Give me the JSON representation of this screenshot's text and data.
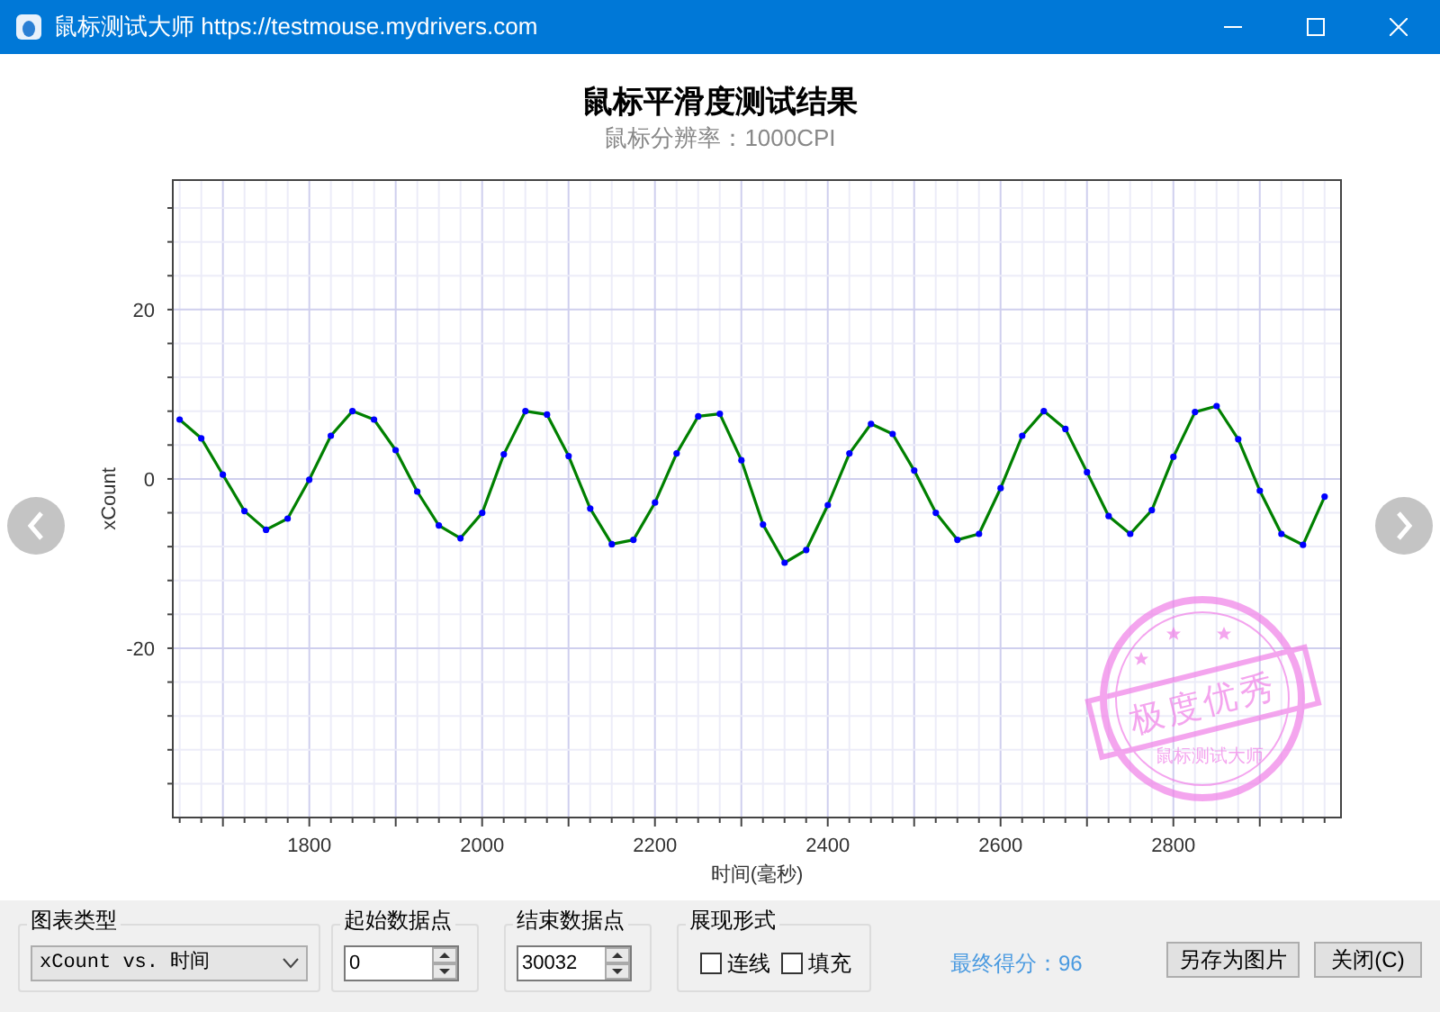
{
  "window": {
    "title": "鼠标测试大师 https://testmouse.mydrivers.com"
  },
  "chart": {
    "title": "鼠标平滑度测试结果",
    "subtitle": "鼠标分辨率：1000CPI",
    "chart_data": {
      "type": "line",
      "xlabel": "时间(毫秒)",
      "ylabel": "xCount",
      "xlim": [
        1642,
        2994
      ],
      "ylim": [
        -40,
        35.3
      ],
      "xticks": [
        1800,
        2000,
        2200,
        2400,
        2600,
        2800
      ],
      "yticks": [
        -20,
        0,
        20
      ],
      "x": [
        1650,
        1675,
        1700,
        1725,
        1750,
        1775,
        1800,
        1825,
        1850,
        1875,
        1900,
        1925,
        1950,
        1975,
        2000,
        2025,
        2050,
        2075,
        2100,
        2125,
        2150,
        2175,
        2200,
        2225,
        2250,
        2275,
        2300,
        2325,
        2350,
        2375,
        2400,
        2425,
        2450,
        2475,
        2500,
        2525,
        2550,
        2575,
        2600,
        2625,
        2650,
        2675,
        2700,
        2725,
        2750,
        2775,
        2800,
        2825,
        2850,
        2875,
        2900,
        2925,
        2950,
        2975
      ],
      "series": [
        {
          "color": "#008000",
          "marker": "circle",
          "values": [
            7,
            4.8,
            0.5,
            -3.8,
            -6,
            -4.7,
            -0.1,
            5.1,
            8,
            7,
            3.4,
            -1.5,
            -5.5,
            -7,
            -4,
            2.9,
            8,
            7.6,
            2.7,
            -3.5,
            -7.7,
            -7.2,
            -2.8,
            3,
            7.4,
            7.7,
            2.2,
            -5.4,
            -9.9,
            -8.4,
            -3.1,
            3,
            6.5,
            5.3,
            1,
            -4,
            -7.2,
            -6.5,
            -1.1,
            5.1,
            8,
            5.9,
            0.8,
            -4.4,
            -6.5,
            -3.7,
            2.6,
            7.9,
            8.6,
            4.7,
            -1.4,
            -6.5,
            -7.8,
            -2.1
          ]
        }
      ],
      "grid": true
    }
  },
  "stamp": {
    "text": "极度优秀",
    "arc_text": "鼠标测试大师"
  },
  "controls": {
    "chart_type": {
      "label": "图表类型",
      "value": "xCount vs. 时间"
    },
    "start_point": {
      "label": "起始数据点",
      "value": "0"
    },
    "end_point": {
      "label": "结束数据点",
      "value": "30032"
    },
    "display": {
      "label": "展现形式",
      "options": [
        {
          "label": "连线",
          "checked": false
        },
        {
          "label": "填充",
          "checked": false
        }
      ]
    },
    "score": "最终得分：96",
    "buttons": [
      "另存为图片",
      "关闭(C)"
    ]
  }
}
